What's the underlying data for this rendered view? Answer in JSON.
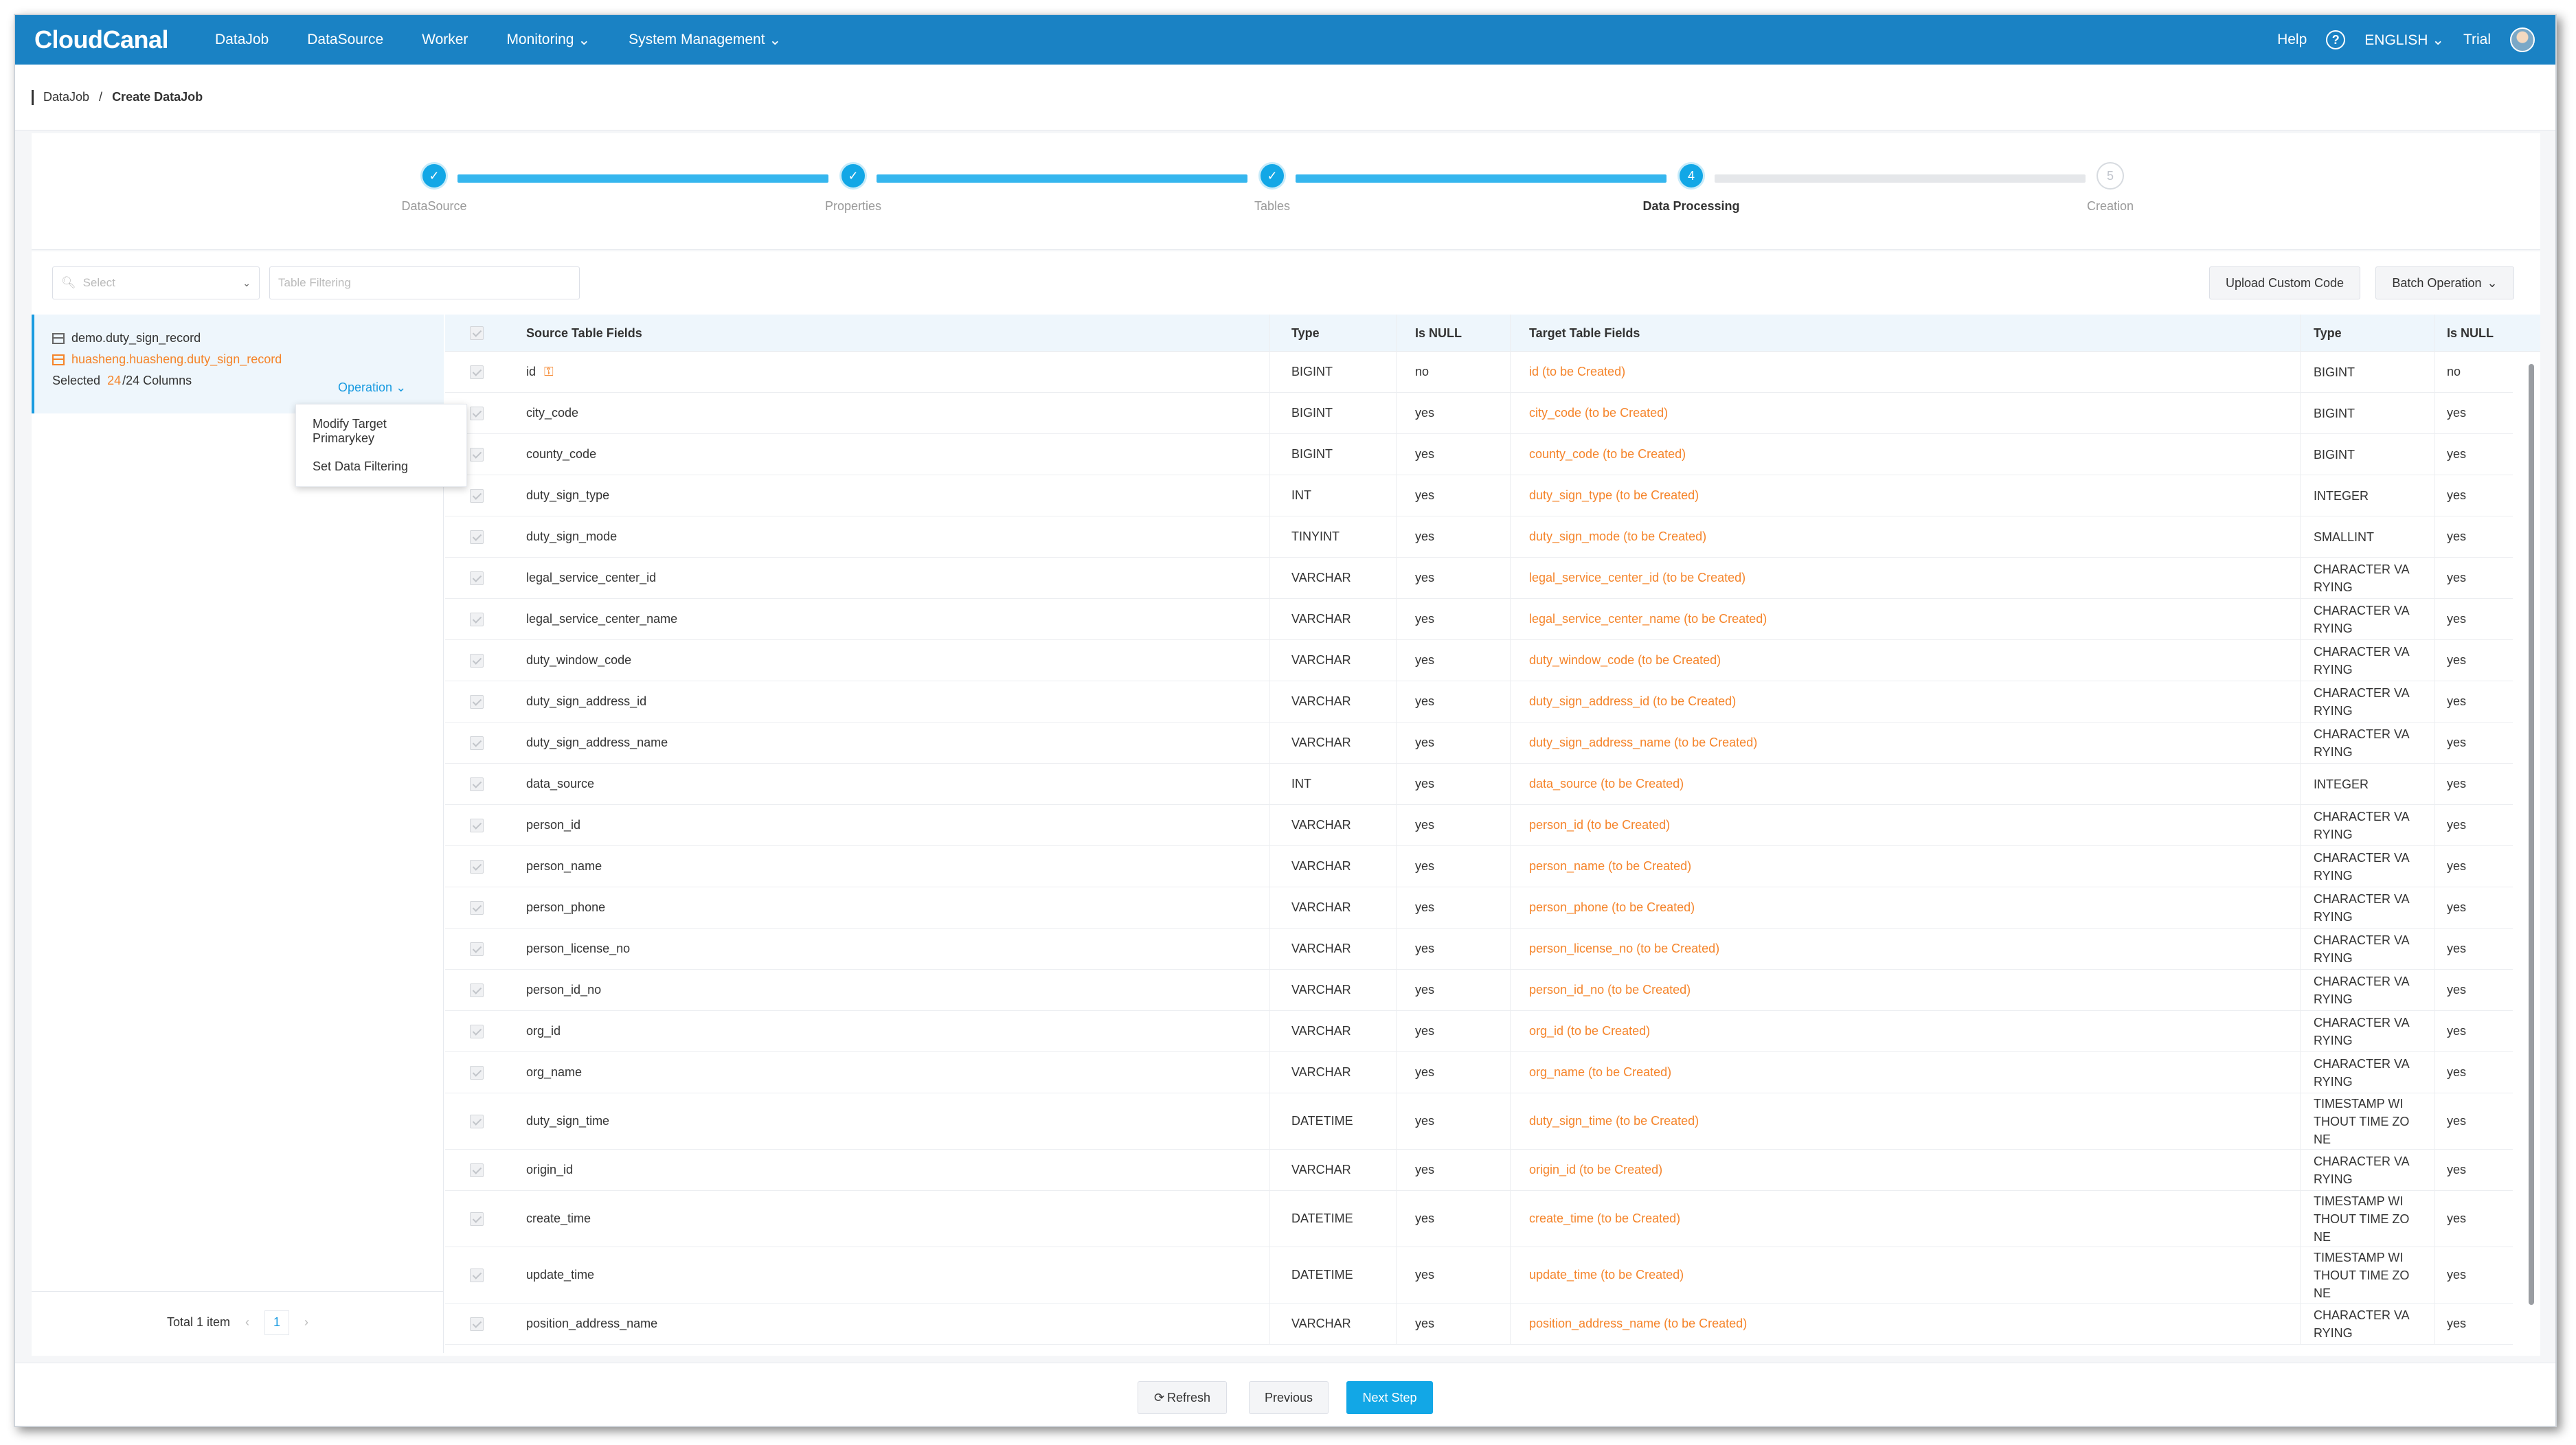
{
  "nav": {
    "logo": "CloudCanal",
    "items": [
      "DataJob",
      "DataSource",
      "Worker",
      "Monitoring",
      "System Management"
    ],
    "help": "Help",
    "language": "ENGLISH",
    "user": "Trial"
  },
  "breadcrumb": {
    "parent": "DataJob",
    "separator": "/",
    "current": "Create DataJob"
  },
  "steps": [
    {
      "label": "DataSource",
      "state": "done"
    },
    {
      "label": "Properties",
      "state": "done"
    },
    {
      "label": "Tables",
      "state": "done"
    },
    {
      "label": "Data Processing",
      "state": "active",
      "number": "4"
    },
    {
      "label": "Creation",
      "state": "pending",
      "number": "5"
    }
  ],
  "toolbar": {
    "select_placeholder": "Select",
    "filter_placeholder": "Table Filtering",
    "upload_label": "Upload Custom Code",
    "batch_label": "Batch Operation"
  },
  "left": {
    "source_table": "demo.duty_sign_record",
    "target_table": "huasheng.huasheng.duty_sign_record",
    "selected_prefix": "Selected",
    "selected_count": "24",
    "selected_suffix": "/24 Columns",
    "operation": "Operation",
    "dropdown": [
      "Modify Target Primarykey",
      "Set Data Filtering"
    ],
    "total": "Total 1 item",
    "page": "1"
  },
  "table": {
    "headers": {
      "source": "Source Table Fields",
      "type": "Type",
      "is_null": "Is NULL",
      "target": "Target Table Fields",
      "target_type": "Type",
      "target_is_null": "Is NULL"
    },
    "rows": [
      {
        "src": "id",
        "type": "BIGINT",
        "null": "no",
        "tgt": "id (to be Created)",
        "ttype": "BIGINT",
        "tnull": "no",
        "pk": true
      },
      {
        "src": "city_code",
        "type": "BIGINT",
        "null": "yes",
        "tgt": "city_code (to be Created)",
        "ttype": "BIGINT",
        "tnull": "yes"
      },
      {
        "src": "county_code",
        "type": "BIGINT",
        "null": "yes",
        "tgt": "county_code (to be Created)",
        "ttype": "BIGINT",
        "tnull": "yes"
      },
      {
        "src": "duty_sign_type",
        "type": "INT",
        "null": "yes",
        "tgt": "duty_sign_type (to be Created)",
        "ttype": "INTEGER",
        "tnull": "yes"
      },
      {
        "src": "duty_sign_mode",
        "type": "TINYINT",
        "null": "yes",
        "tgt": "duty_sign_mode (to be Created)",
        "ttype": "SMALLINT",
        "tnull": "yes"
      },
      {
        "src": "legal_service_center_id",
        "type": "VARCHAR",
        "null": "yes",
        "tgt": "legal_service_center_id (to be Created)",
        "ttype": "CHARACTER VARYING",
        "tnull": "yes"
      },
      {
        "src": "legal_service_center_name",
        "type": "VARCHAR",
        "null": "yes",
        "tgt": "legal_service_center_name (to be Created)",
        "ttype": "CHARACTER VARYING",
        "tnull": "yes"
      },
      {
        "src": "duty_window_code",
        "type": "VARCHAR",
        "null": "yes",
        "tgt": "duty_window_code (to be Created)",
        "ttype": "CHARACTER VARYING",
        "tnull": "yes"
      },
      {
        "src": "duty_sign_address_id",
        "type": "VARCHAR",
        "null": "yes",
        "tgt": "duty_sign_address_id (to be Created)",
        "ttype": "CHARACTER VARYING",
        "tnull": "yes"
      },
      {
        "src": "duty_sign_address_name",
        "type": "VARCHAR",
        "null": "yes",
        "tgt": "duty_sign_address_name (to be Created)",
        "ttype": "CHARACTER VARYING",
        "tnull": "yes"
      },
      {
        "src": "data_source",
        "type": "INT",
        "null": "yes",
        "tgt": "data_source (to be Created)",
        "ttype": "INTEGER",
        "tnull": "yes"
      },
      {
        "src": "person_id",
        "type": "VARCHAR",
        "null": "yes",
        "tgt": "person_id (to be Created)",
        "ttype": "CHARACTER VARYING",
        "tnull": "yes"
      },
      {
        "src": "person_name",
        "type": "VARCHAR",
        "null": "yes",
        "tgt": "person_name (to be Created)",
        "ttype": "CHARACTER VARYING",
        "tnull": "yes"
      },
      {
        "src": "person_phone",
        "type": "VARCHAR",
        "null": "yes",
        "tgt": "person_phone (to be Created)",
        "ttype": "CHARACTER VARYING",
        "tnull": "yes"
      },
      {
        "src": "person_license_no",
        "type": "VARCHAR",
        "null": "yes",
        "tgt": "person_license_no (to be Created)",
        "ttype": "CHARACTER VARYING",
        "tnull": "yes"
      },
      {
        "src": "person_id_no",
        "type": "VARCHAR",
        "null": "yes",
        "tgt": "person_id_no (to be Created)",
        "ttype": "CHARACTER VARYING",
        "tnull": "yes"
      },
      {
        "src": "org_id",
        "type": "VARCHAR",
        "null": "yes",
        "tgt": "org_id (to be Created)",
        "ttype": "CHARACTER VARYING",
        "tnull": "yes"
      },
      {
        "src": "org_name",
        "type": "VARCHAR",
        "null": "yes",
        "tgt": "org_name (to be Created)",
        "ttype": "CHARACTER VARYING",
        "tnull": "yes"
      },
      {
        "src": "duty_sign_time",
        "type": "DATETIME",
        "null": "yes",
        "tgt": "duty_sign_time (to be Created)",
        "ttype": "TIMESTAMP WITHOUT TIME ZONE",
        "tnull": "yes"
      },
      {
        "src": "origin_id",
        "type": "VARCHAR",
        "null": "yes",
        "tgt": "origin_id (to be Created)",
        "ttype": "CHARACTER VARYING",
        "tnull": "yes"
      },
      {
        "src": "create_time",
        "type": "DATETIME",
        "null": "yes",
        "tgt": "create_time (to be Created)",
        "ttype": "TIMESTAMP WITHOUT TIME ZONE",
        "tnull": "yes"
      },
      {
        "src": "update_time",
        "type": "DATETIME",
        "null": "yes",
        "tgt": "update_time (to be Created)",
        "ttype": "TIMESTAMP WITHOUT TIME ZONE",
        "tnull": "yes"
      },
      {
        "src": "position_address_name",
        "type": "VARCHAR",
        "null": "yes",
        "tgt": "position_address_name (to be Created)",
        "ttype": "CHARACTER VARYING",
        "tnull": "yes"
      }
    ]
  },
  "footer": {
    "refresh": "Refresh",
    "previous": "Previous",
    "next": "Next Step"
  },
  "colors": {
    "nav": "#1a82c4",
    "accent": "#12a7e6",
    "orange": "#f5842a"
  }
}
